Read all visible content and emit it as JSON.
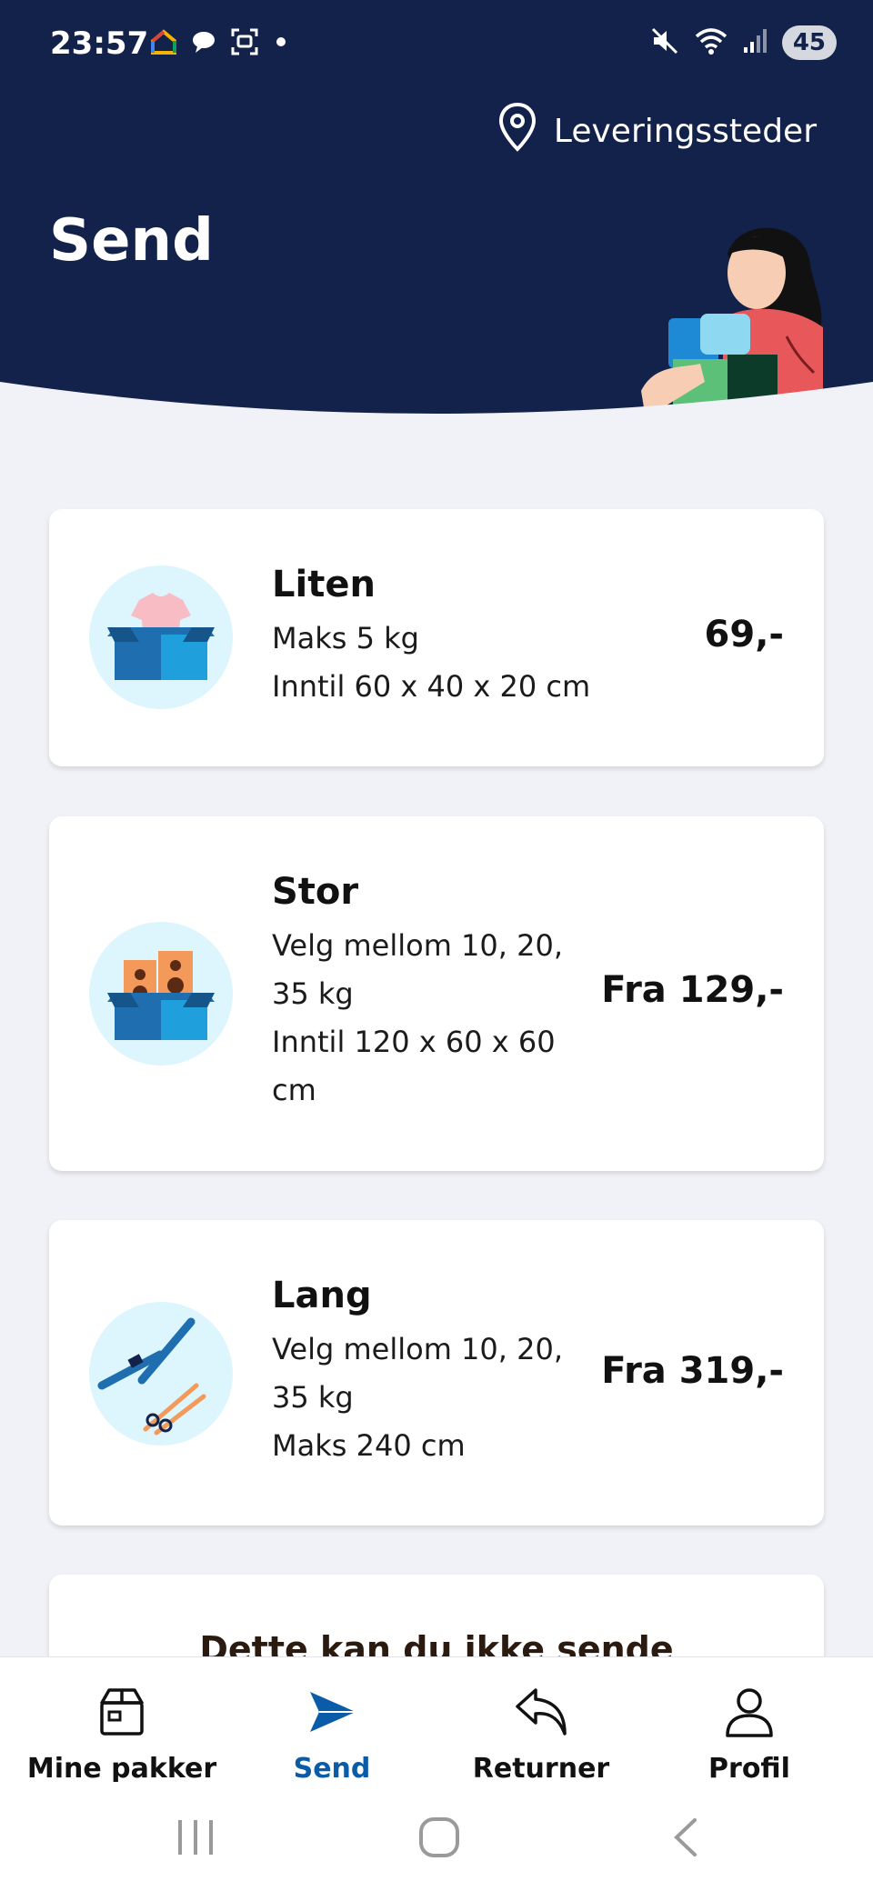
{
  "status_bar": {
    "time": "23:57",
    "battery": "45",
    "icons_left": [
      "home-app-icon",
      "chat-icon",
      "screenshot-icon",
      "dot-icon"
    ],
    "icons_right": [
      "mute-icon",
      "wifi-icon",
      "signal-icon",
      "battery-icon"
    ]
  },
  "header": {
    "location_label": "Leveringssteder",
    "title": "Send"
  },
  "cards": [
    {
      "title": "Liten",
      "lines": [
        "Maks 5 kg",
        "Inntil 60 x 40 x 20 cm"
      ],
      "price": "69,-",
      "icon": "tshirt-box-icon"
    },
    {
      "title": "Stor",
      "lines": [
        "Velg mellom 10, 20,",
        "35 kg",
        "Inntil 120 x 60 x 60",
        "cm"
      ],
      "price": "Fra 129,-",
      "icon": "speakers-box-icon"
    },
    {
      "title": "Lang",
      "lines": [
        "Velg mellom 10, 20,",
        "35 kg",
        "Maks 240 cm"
      ],
      "price": "Fra 319,-",
      "icon": "skis-icon"
    }
  ],
  "partial_card": {
    "title": "Dette kan du ikke sende"
  },
  "bottom_nav": [
    {
      "label": "Mine pakker",
      "icon": "package-icon",
      "active": false
    },
    {
      "label": "Send",
      "icon": "send-icon",
      "active": true
    },
    {
      "label": "Returner",
      "icon": "return-icon",
      "active": false
    },
    {
      "label": "Profil",
      "icon": "profile-icon",
      "active": false
    }
  ],
  "colors": {
    "header_bg": "#13224A",
    "page_bg": "#F1F2F7",
    "active_nav": "#0B5CA8",
    "icon_circle": "#DDF5FC"
  }
}
